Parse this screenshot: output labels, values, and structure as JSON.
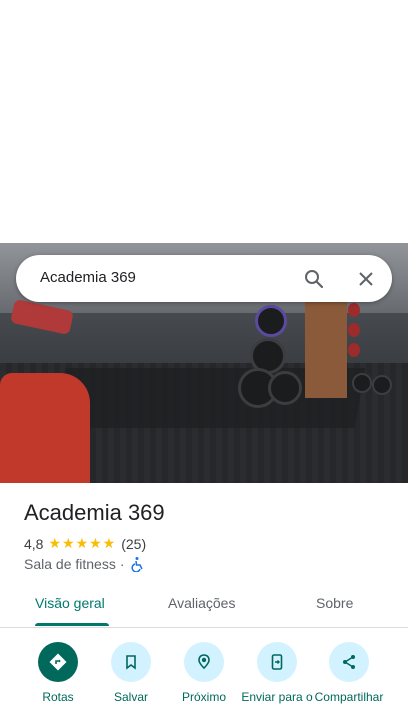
{
  "search": {
    "query": "Academia 369"
  },
  "place": {
    "name": "Academia 369",
    "rating": "4,8",
    "stars": "★★★★★",
    "review_count": "(25)",
    "category": "Sala de fitness",
    "separator": "·"
  },
  "tabs": [
    {
      "label": "Visão geral",
      "active": true
    },
    {
      "label": "Avaliações",
      "active": false
    },
    {
      "label": "Sobre",
      "active": false
    }
  ],
  "actions": [
    {
      "label": "Rotas",
      "icon": "directions-icon"
    },
    {
      "label": "Salvar",
      "icon": "bookmark-icon"
    },
    {
      "label": "Próximo",
      "icon": "nearby-icon"
    },
    {
      "label": "Enviar para o",
      "icon": "send-to-phone-icon"
    },
    {
      "label": "Compartilhar",
      "icon": "share-icon"
    }
  ],
  "colors": {
    "accent": "#00796b",
    "action_primary": "#00695c",
    "action_bg": "#d2f2ff",
    "star": "#fbbc04",
    "accessibility": "#1a73e8"
  }
}
